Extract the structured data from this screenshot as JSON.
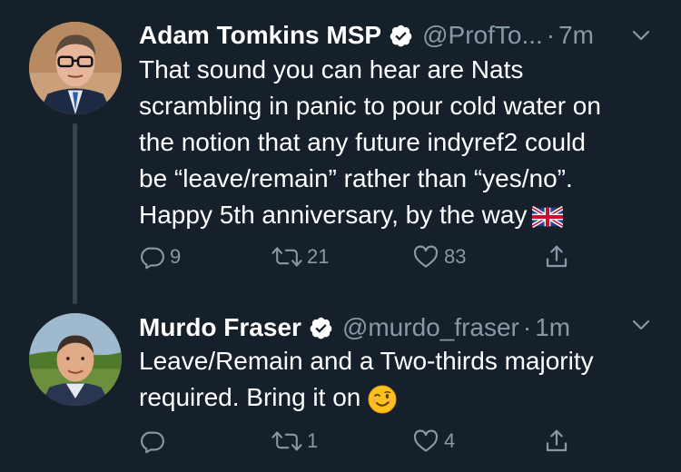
{
  "tweets": [
    {
      "display_name": "Adam Tomkins MSP",
      "handle": "@ProfTo...",
      "separator": "·",
      "time": "7m",
      "lines": [
        "That sound you can hear are Nats",
        "scrambling in panic to pour cold water on",
        "the notion that any future indyref2 could",
        "be “leave/remain” rather than “yes/no”.",
        "Happy 5th anniversary, by the way"
      ],
      "emoji": "uk-flag-icon",
      "replies": "9",
      "retweets": "21",
      "likes": "83"
    },
    {
      "display_name": "Murdo Fraser",
      "handle": "@murdo_fraser",
      "separator": "·",
      "time": "1m",
      "lines": [
        "Leave/Remain and a Two-thirds majority",
        "required. Bring it on"
      ],
      "emoji": "winking-face-icon",
      "replies": "",
      "retweets": "1",
      "likes": "4"
    }
  ],
  "colors": {
    "background": "#15202b",
    "text": "#ffffff",
    "muted": "#8899a6",
    "thread_line": "#38444d"
  },
  "icons": [
    "reply-icon",
    "retweet-icon",
    "like-icon",
    "share-icon",
    "verified-badge-icon",
    "chevron-down-icon"
  ]
}
